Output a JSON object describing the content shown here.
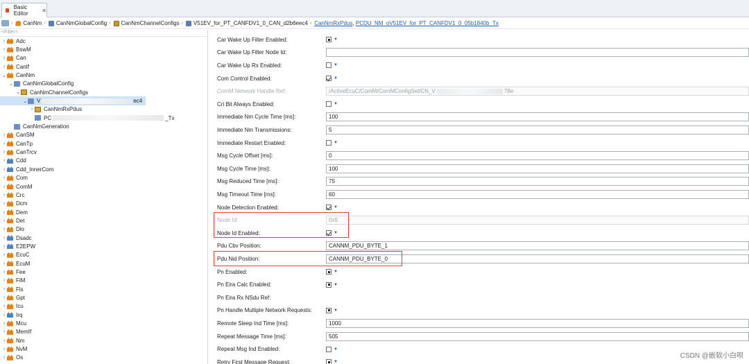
{
  "tab": {
    "title": "Basic Editor",
    "close": "✕"
  },
  "breadcrumb": {
    "items": [
      "CanNm",
      "CanNmGlobalConfig",
      "CanNmChannelConfigs",
      "V51EV_for_PT_CANFDV1_0_CAN_d2b6eec4"
    ],
    "links": [
      "CanNmRxPdus",
      "PCDU_NM_oV51EV_for_PT_CANFDV1_0_05b1840b_Tx"
    ],
    "link_sep": ","
  },
  "tree": {
    "filter_placeholder": "<Filter>",
    "items": [
      {
        "label": "Adc",
        "level": 0,
        "icon": "module",
        "expand": "›"
      },
      {
        "label": "BswM",
        "level": 0,
        "icon": "module",
        "expand": "›"
      },
      {
        "label": "Can",
        "level": 0,
        "icon": "module",
        "expand": "›"
      },
      {
        "label": "CanIf",
        "level": 0,
        "icon": "module",
        "expand": "›"
      },
      {
        "label": "CanNm",
        "level": 0,
        "icon": "module",
        "expand": "⌄"
      },
      {
        "label": "CanNmGlobalConfig",
        "level": 1,
        "icon": "container",
        "expand": "⌄"
      },
      {
        "label": "CanNmChannelConfigs",
        "level": 2,
        "icon": "container-yellow",
        "expand": "⌄"
      },
      {
        "label": "V",
        "suffix": "ec4",
        "level": 3,
        "icon": "container",
        "expand": "⌄",
        "selected": true
      },
      {
        "label": "CanNmRxPdus",
        "level": 4,
        "icon": "container-yellow",
        "expand": "›"
      },
      {
        "label": "PC",
        "suffix": "_Tx",
        "level": 4,
        "icon": "container",
        "expand": ""
      },
      {
        "label": "CanNmGeneration",
        "level": 1,
        "icon": "container",
        "expand": ""
      },
      {
        "label": "CanSM",
        "level": 0,
        "icon": "module",
        "expand": "›"
      },
      {
        "label": "CanTp",
        "level": 0,
        "icon": "module",
        "expand": "›"
      },
      {
        "label": "CanTrcv",
        "level": 0,
        "icon": "module",
        "expand": "›"
      },
      {
        "label": "Cdd",
        "level": 0,
        "icon": "module-blue",
        "expand": "›"
      },
      {
        "label": "Cdd_InnerCom",
        "level": 0,
        "icon": "module-blue",
        "expand": "›"
      },
      {
        "label": "Com",
        "level": 0,
        "icon": "module",
        "expand": "›"
      },
      {
        "label": "ComM",
        "level": 0,
        "icon": "module",
        "expand": "›"
      },
      {
        "label": "Crc",
        "level": 0,
        "icon": "module",
        "expand": "›"
      },
      {
        "label": "Dcm",
        "level": 0,
        "icon": "module",
        "expand": "›"
      },
      {
        "label": "Dem",
        "level": 0,
        "icon": "module",
        "expand": "›"
      },
      {
        "label": "Det",
        "level": 0,
        "icon": "module",
        "expand": "›"
      },
      {
        "label": "Dio",
        "level": 0,
        "icon": "module",
        "expand": "›"
      },
      {
        "label": "Dsadc",
        "level": 0,
        "icon": "module-blue",
        "expand": "›"
      },
      {
        "label": "E2EPW",
        "level": 0,
        "icon": "module-blue",
        "expand": "›"
      },
      {
        "label": "EcuC",
        "level": 0,
        "icon": "module",
        "expand": "›"
      },
      {
        "label": "EcuM",
        "level": 0,
        "icon": "module",
        "expand": "›"
      },
      {
        "label": "Fee",
        "level": 0,
        "icon": "module",
        "expand": "›"
      },
      {
        "label": "FiM",
        "level": 0,
        "icon": "module",
        "expand": "›"
      },
      {
        "label": "Fls",
        "level": 0,
        "icon": "module",
        "expand": "›"
      },
      {
        "label": "Gpt",
        "level": 0,
        "icon": "module",
        "expand": "›"
      },
      {
        "label": "Icu",
        "level": 0,
        "icon": "module",
        "expand": "›"
      },
      {
        "label": "Irq",
        "level": 0,
        "icon": "module-blue",
        "expand": "›"
      },
      {
        "label": "Mcu",
        "level": 0,
        "icon": "module",
        "expand": "›"
      },
      {
        "label": "MemIf",
        "level": 0,
        "icon": "module",
        "expand": "›"
      },
      {
        "label": "Nm",
        "level": 0,
        "icon": "module",
        "expand": "›"
      },
      {
        "label": "NvM",
        "level": 0,
        "icon": "module",
        "expand": "›"
      },
      {
        "label": "Os",
        "level": 0,
        "icon": "module",
        "expand": "›"
      }
    ]
  },
  "params": [
    {
      "label": "Car Wake Up Filter Enabled:",
      "type": "tri"
    },
    {
      "label": "Car Wake Up Filter Node Id:",
      "type": "text",
      "value": ""
    },
    {
      "label": "Car Wake Up Rx Enabled:",
      "type": "check",
      "checked": false
    },
    {
      "label": "Com Control Enabled:",
      "type": "check",
      "checked": true
    },
    {
      "label": "ComM Network Handle Ref:",
      "type": "disabled",
      "value": "/ActiveEcuC/ComM/ComMConfigSet/CN_V",
      "value_suffix": "78e"
    },
    {
      "label": "Cri Bit Always Enabled:",
      "type": "check",
      "checked": false
    },
    {
      "label": "Immediate Nm Cycle Time [ms]:",
      "type": "text",
      "value": "100"
    },
    {
      "label": "Immediate Nm Transmissions:",
      "type": "text",
      "value": "5"
    },
    {
      "label": "Immediate Restart Enabled:",
      "type": "check",
      "checked": false
    },
    {
      "label": "Msg Cycle Offset [ms]:",
      "type": "text",
      "value": "0"
    },
    {
      "label": "Msg Cycle Time [ms]:",
      "type": "text",
      "value": "100"
    },
    {
      "label": "Msg Reduced Time [ms]:",
      "type": "text",
      "value": "75"
    },
    {
      "label": "Msg Timeout Time [ms]:",
      "type": "text",
      "value": "60"
    },
    {
      "label": "Node Detection Enabled:",
      "type": "check",
      "checked": true
    },
    {
      "label": "Node Id:",
      "type": "disabled",
      "value": "0x5"
    },
    {
      "label": "Node Id Enabled:",
      "type": "check",
      "checked": true
    },
    {
      "label": "Pdu Cbv Position:",
      "type": "text",
      "value": "CANNM_PDU_BYTE_1"
    },
    {
      "label": "Pdu Nid Position:",
      "type": "text",
      "value": "CANNM_PDU_BYTE_0"
    },
    {
      "label": "Pn Enabled:",
      "type": "tri"
    },
    {
      "label": "Pn Eira Calc Enabled:",
      "type": "tri"
    },
    {
      "label": "Pn Eira Rx NSdu Ref:",
      "type": "none"
    },
    {
      "label": "Pn Handle Multiple Network Requests:",
      "type": "tri"
    },
    {
      "label": "Remote Sleep Ind Time [ms]:",
      "type": "text",
      "value": "1000"
    },
    {
      "label": "Repeat Message Time [ms]:",
      "type": "text",
      "value": "505"
    },
    {
      "label": "Repeat Msg Ind Enabled:",
      "type": "check",
      "checked": false
    },
    {
      "label": "Retry First Message Request:",
      "type": "tri"
    }
  ],
  "watermark": "CSDN @嵌软小白呗",
  "colors": {
    "highlight_box": "#e0443e",
    "link": "#1f5fc0",
    "selection": "#cfe3f7"
  }
}
